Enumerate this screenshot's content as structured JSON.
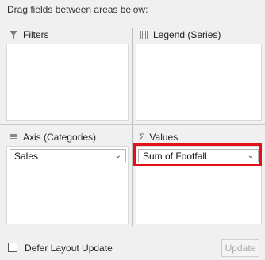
{
  "instructions": "Drag fields between areas below:",
  "areas": {
    "filters": {
      "title": "Filters",
      "icon": "filter-icon"
    },
    "legend": {
      "title": "Legend (Series)",
      "icon": "columns-icon"
    },
    "axis": {
      "title": "Axis (Categories)",
      "icon": "rows-icon",
      "fields": [
        "Sales"
      ]
    },
    "values": {
      "title": "Values",
      "icon": "sigma-icon",
      "fields": [
        "Sum of Footfall"
      ]
    }
  },
  "footer": {
    "defer_label": "Defer Layout Update",
    "defer_checked": false,
    "update_label": "Update"
  },
  "colors": {
    "highlight": "#e0111b"
  }
}
